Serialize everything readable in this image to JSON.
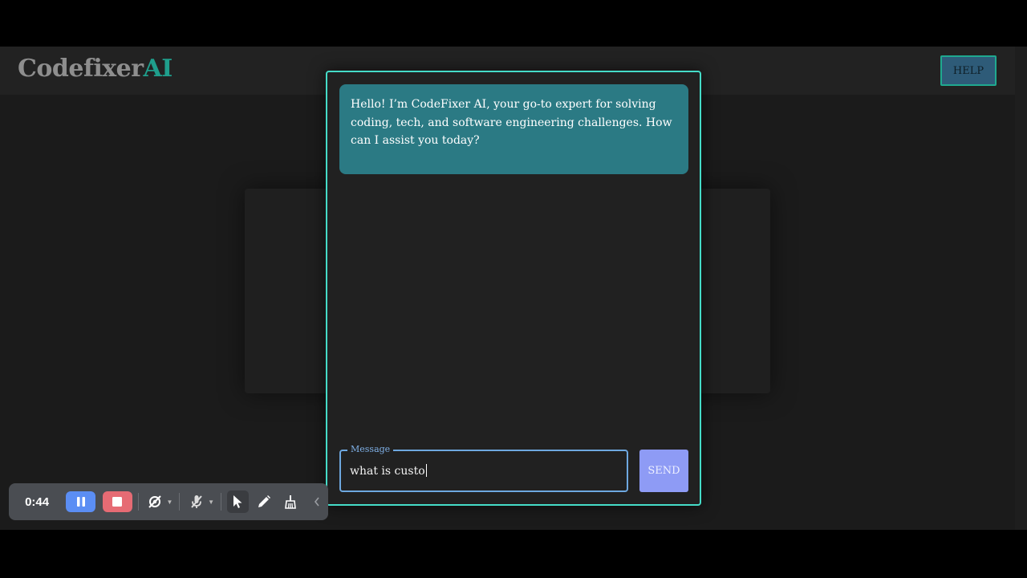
{
  "header": {
    "logo_part1": "Codefixer",
    "logo_part2": "AI",
    "help_label": "HELP"
  },
  "chat": {
    "bot_message": "Hello! I’m CodeFixer AI, your go-to expert for solving coding, tech, and software engineering challenges. How can I assist you today?",
    "input_label": "Message",
    "input_value": "what is custo",
    "send_label": "SEND"
  },
  "recorder": {
    "time": "0:44",
    "icons": [
      "pause-icon",
      "stop-icon",
      "camera-off-icon",
      "microphone-off-icon",
      "pointer-icon",
      "pen-icon",
      "eraser-icon",
      "collapse-chevron-icon"
    ]
  },
  "colors": {
    "accent_teal": "#45dcc8",
    "bubble_bg": "#2b7a84",
    "send_bg": "#8e9bf5",
    "logo_ai": "#1f9e8c"
  }
}
